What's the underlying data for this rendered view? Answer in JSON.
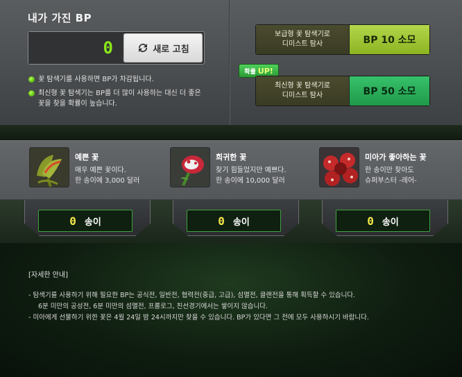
{
  "bp_panel": {
    "title": "내가 가진 BP",
    "value": "0",
    "refresh_label": "새로 고침",
    "notes": [
      "꽃 탐색기를 사용하면 BP가 차감됩니다.",
      "최신형 꽃 탐색기는 BP를 더 많이 사용하는 대신 더 좋은",
      "꽃을 찾을 확률이 높습니다."
    ]
  },
  "search": {
    "basic_label_line1": "보급형 꽃 탐색기로",
    "basic_label_line2": "디미스트 탐사",
    "basic_button": "BP 10 소모",
    "probability_badge": "확률",
    "probability_up": "UP!",
    "advanced_label_line1": "최신형 꽃 탐색기로",
    "advanced_label_line2": "디미스트 탐사",
    "advanced_button": "BP 50 소모"
  },
  "flowers": [
    {
      "name": "예쁜 꽃",
      "desc1": "매우 예쁜 꽃이다.",
      "desc2": "한 송이에 3,000 달러",
      "count": "0",
      "unit": "송이"
    },
    {
      "name": "희귀한 꽃",
      "desc1": "찾기 힘들었지만 예쁘다.",
      "desc2": "한 송이에 10,000 달러",
      "count": "0",
      "unit": "송이"
    },
    {
      "name": "미아가 좋아하는 꽃",
      "desc1": "한 송이만 찾아도",
      "desc2": "슈퍼부스터 -레어-",
      "count": "0",
      "unit": "송이"
    }
  ],
  "info": {
    "title": "[자세한 안내]",
    "line1": "- 탐색기를 사용하기 위해 필요한 BP는 공식전, 일반전, 협력전(중급, 고급), 섬멸전, 클랜전을 통해 획득할 수 있습니다.",
    "line2": "6분 미만의 공성전, 6분 미만의 섬멸전, 프롤로그, 친선경기에서는 쌓이지 않습니다.",
    "line3": "- 미아에게 선물하기 위한 꽃은 4월 24일 밤 24시까지만 찾을 수 있습니다. BP가 있다면 그 전에 모두 사용하시기 바랍니다."
  },
  "colors": {
    "bp_value": "#8be81a",
    "count_number": "#f5e84a",
    "basic_button": "#a6c93a",
    "advanced_button": "#2db55c",
    "note_dot": "#5fbf12"
  }
}
